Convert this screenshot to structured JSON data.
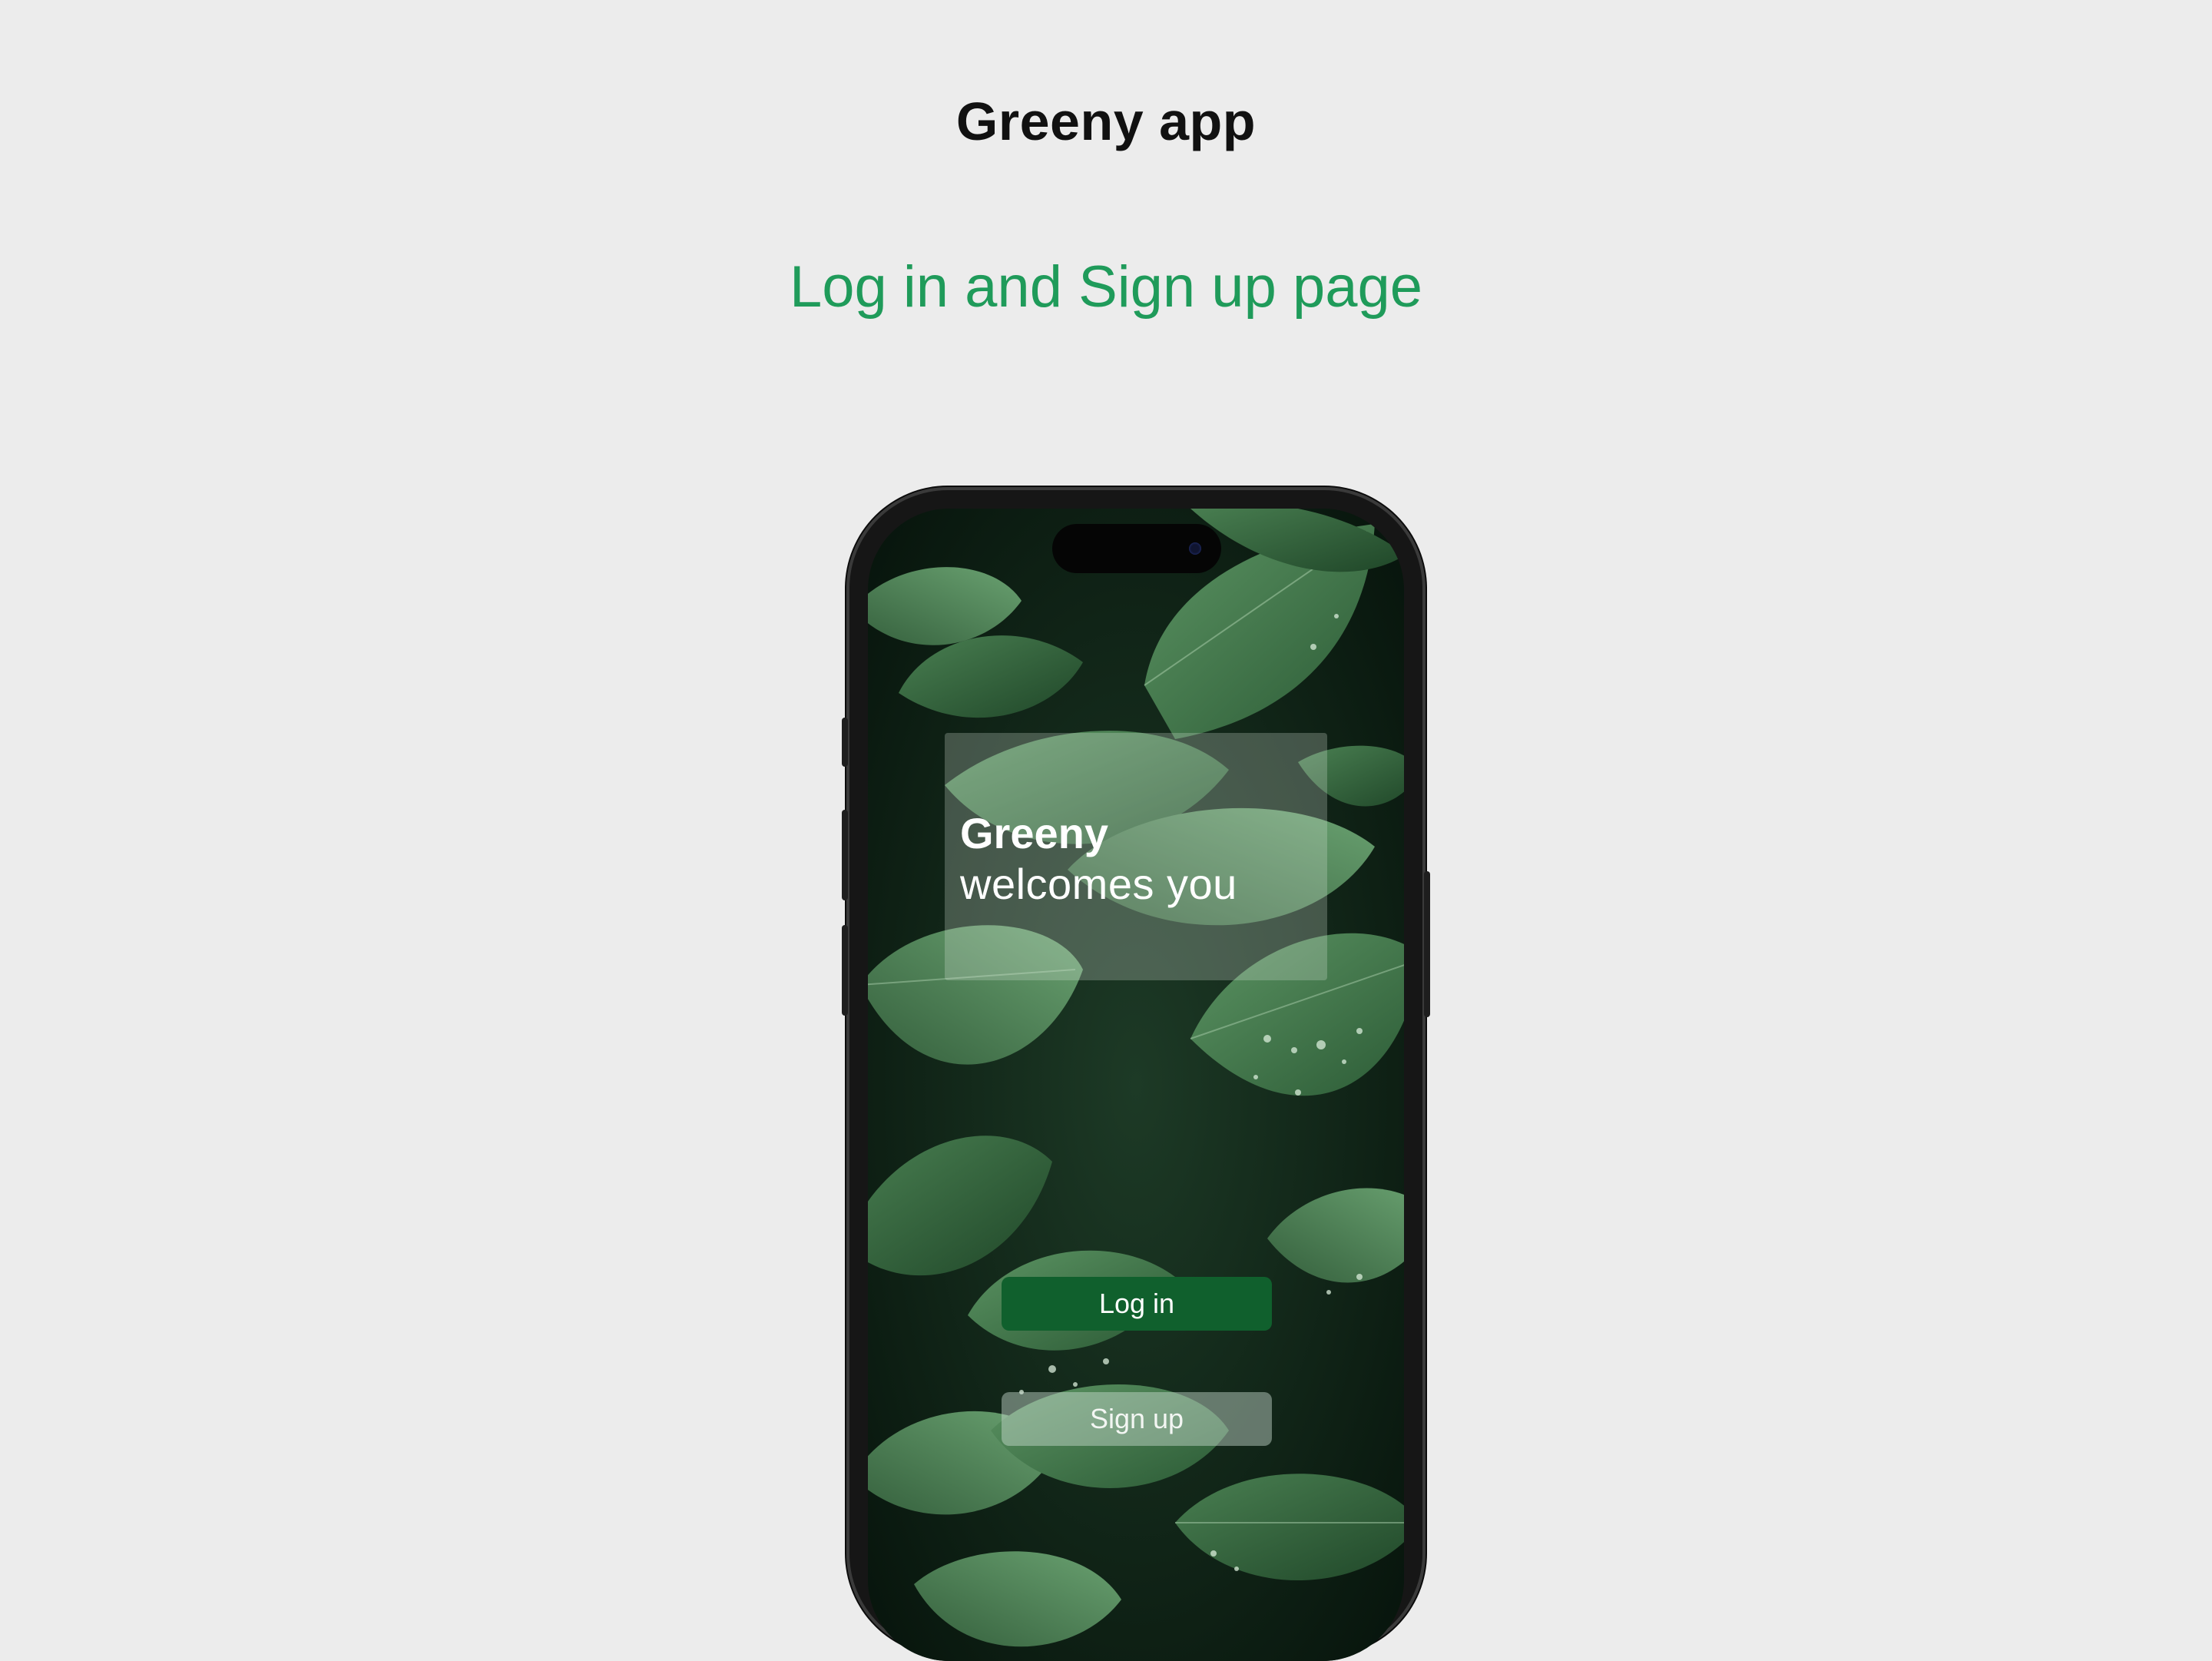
{
  "header": {
    "title": "Greeny app",
    "subtitle": "Log in and Sign up page"
  },
  "phone": {
    "welcome": {
      "brand": "Greeny",
      "tagline": "welcomes you"
    },
    "buttons": {
      "login_label": "Log in",
      "signup_label": "Sign up"
    }
  },
  "colors": {
    "page_background": "#ececec",
    "accent_green": "#1f9b5a",
    "login_button": "#10602d",
    "title_text": "#111111"
  },
  "icons": {
    "camera": "camera-icon"
  }
}
